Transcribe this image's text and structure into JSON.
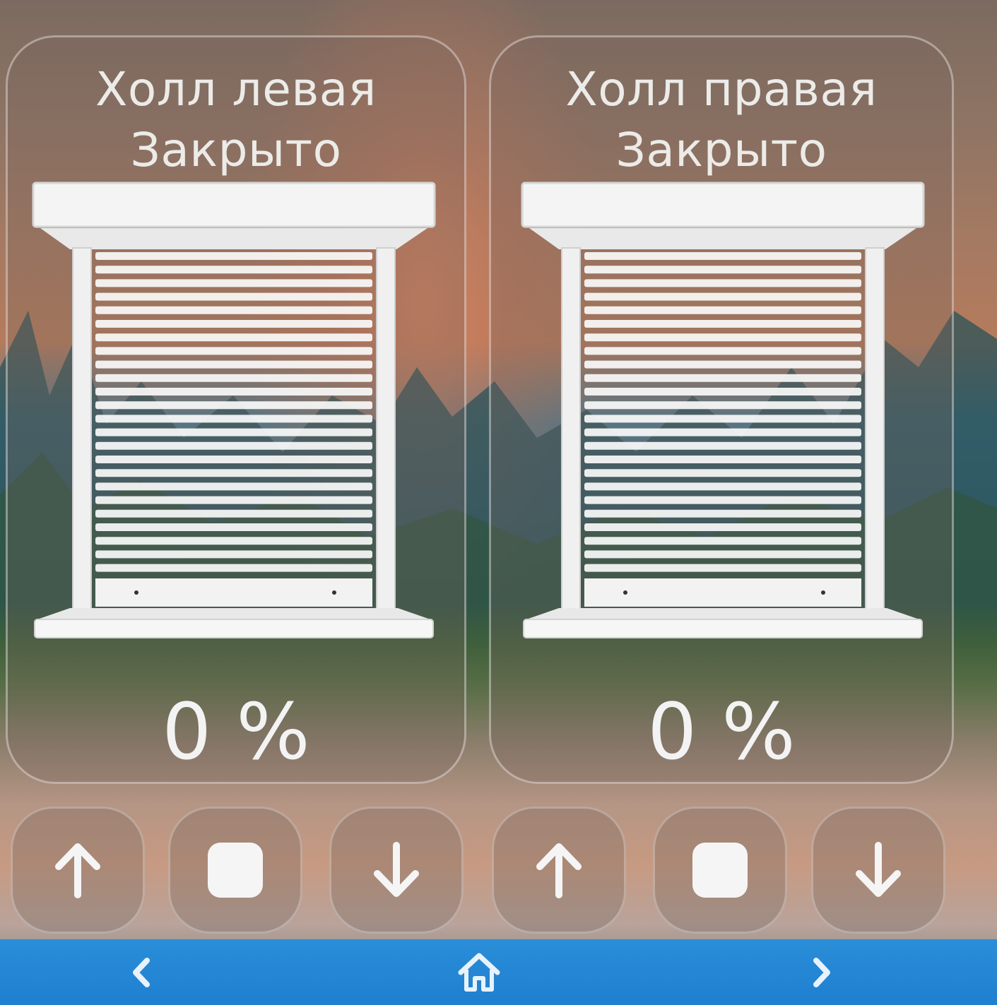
{
  "blinds": [
    {
      "title": "Холл левая",
      "status": "Закрыто",
      "position_text": "0 %",
      "position_value": 0
    },
    {
      "title": "Холл правая",
      "status": "Закрыто",
      "position_text": "0 %",
      "position_value": 0
    }
  ],
  "controls": {
    "up_icon": "arrow-up-icon",
    "stop_icon": "stop-square-icon",
    "down_icon": "arrow-down-icon"
  },
  "navbar": {
    "prev_icon": "chevron-left-icon",
    "home_icon": "home-icon",
    "next_icon": "chevron-right-icon",
    "color": "#2287d4"
  }
}
